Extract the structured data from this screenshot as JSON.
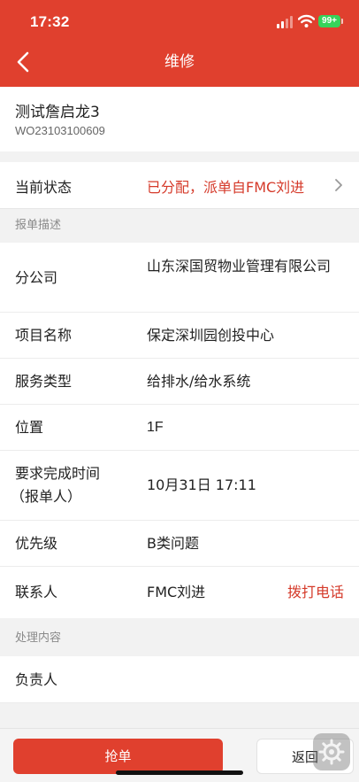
{
  "status_bar": {
    "time": "17:32",
    "battery": "99+"
  },
  "header": {
    "title": "维修"
  },
  "ticket": {
    "name": "测试詹启龙3",
    "code": "WO23103100609"
  },
  "current_status": {
    "label": "当前状态",
    "value": "已分配，派单自FMC刘进"
  },
  "sections": {
    "description": "报单描述",
    "processing": "处理内容"
  },
  "details": [
    {
      "label": "分公司",
      "value": "山东深国贸物业管理有限公司"
    },
    {
      "label": "项目名称",
      "value": "保定深圳园创投中心"
    },
    {
      "label": "服务类型",
      "value": "给排水/给水系统"
    },
    {
      "label": "位置",
      "value": "1F"
    },
    {
      "label": "要求完成时间",
      "label2": "（报单人）",
      "value": "10月31日 17:11"
    },
    {
      "label": "优先级",
      "value": "B类问题"
    },
    {
      "label": "联系人",
      "value": "FMC刘进",
      "action": "拨打电话"
    }
  ],
  "processing": [
    {
      "label": "负责人",
      "value": ""
    }
  ],
  "actions": {
    "grab": "抢单",
    "return": "返回"
  },
  "colors": {
    "primary": "#e0402e",
    "accent_text": "#d53a2a",
    "battery": "#36d35a"
  }
}
